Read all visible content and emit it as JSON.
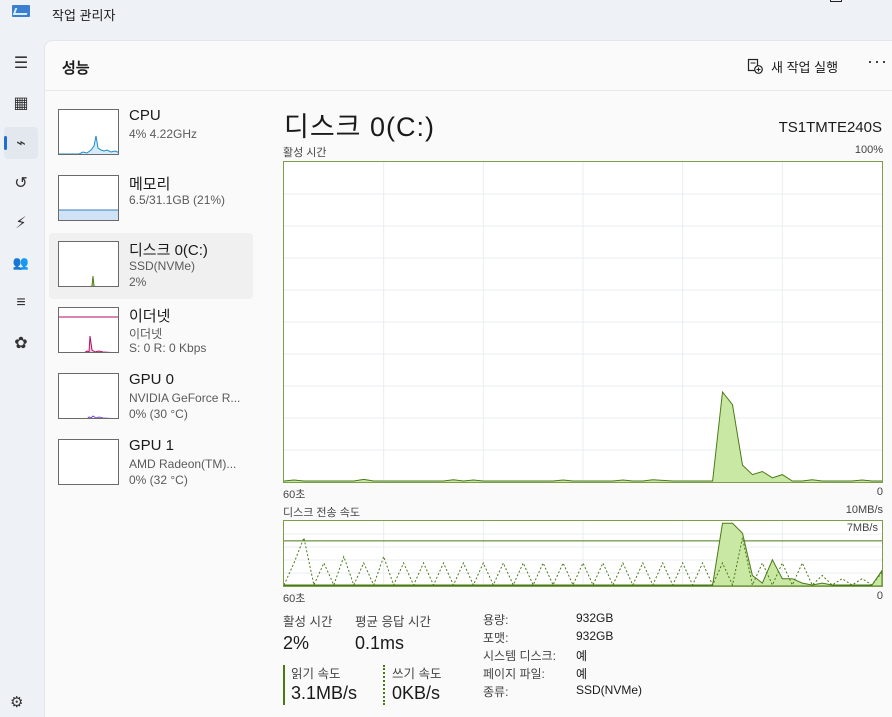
{
  "window": {
    "title": "작업 관리자"
  },
  "header": {
    "page_title": "성능",
    "new_task_label": "새 작업 실행",
    "more_label": "···"
  },
  "rail": {
    "items": [
      {
        "name": "hamburger-icon",
        "glyph": "☰"
      },
      {
        "name": "processes-icon",
        "glyph": "▦"
      },
      {
        "name": "performance-icon",
        "glyph": "⌁"
      },
      {
        "name": "app-history-icon",
        "glyph": "↺"
      },
      {
        "name": "startup-apps-icon",
        "glyph": "⚡"
      },
      {
        "name": "users-icon",
        "glyph": "👥"
      },
      {
        "name": "details-icon",
        "glyph": "≡"
      },
      {
        "name": "services-icon",
        "glyph": "✿"
      }
    ],
    "settings_glyph": "⚙"
  },
  "devices": [
    {
      "name": "CPU",
      "line1": "4% 4.22GHz",
      "line2": ""
    },
    {
      "name": "메모리",
      "line1": "6.5/31.1GB (21%)",
      "line2": ""
    },
    {
      "name": "디스크 0(C:)",
      "line1": "SSD(NVMe)",
      "line2": "2%"
    },
    {
      "name": "이더넷",
      "line1": "이더넷",
      "line2": "S: 0 R: 0 Kbps"
    },
    {
      "name": "GPU 0",
      "line1": "NVIDIA GeForce R...",
      "line2": "0% (30 °C)"
    },
    {
      "name": "GPU 1",
      "line1": "AMD Radeon(TM)...",
      "line2": "0% (32 °C)"
    }
  ],
  "detail": {
    "title": "디스크 0(C:)",
    "model": "TS1TMTE240S",
    "active_chart": {
      "label": "활성 시간",
      "max_label": "100%",
      "x_left": "60초",
      "x_right": "0",
      "values": [
        0,
        0.3,
        0,
        0,
        0,
        0,
        0,
        0,
        0.5,
        0,
        0,
        0,
        0,
        0,
        0,
        0,
        0,
        0.4,
        0,
        0.3,
        0,
        0,
        0,
        0,
        0,
        0,
        0,
        0,
        0.3,
        0,
        0,
        0,
        0,
        0,
        0.3,
        0,
        0,
        0.4,
        0.2,
        0,
        0,
        0,
        0,
        0,
        28,
        24,
        5,
        2,
        3,
        1,
        2,
        0,
        0,
        0.4,
        0,
        0,
        0,
        0,
        0.3,
        0,
        0
      ]
    },
    "transfer_chart": {
      "label": "디스크 전송 속도",
      "max_label": "10MB/s",
      "ref_label": "7MB/s",
      "x_left": "60초",
      "x_right": "0",
      "read": [
        0,
        0,
        0,
        0,
        0,
        0,
        0,
        0,
        0,
        0,
        0,
        0,
        0,
        0,
        0,
        0,
        0,
        0,
        0,
        0,
        0,
        0,
        0,
        0,
        0,
        0,
        0,
        0,
        0,
        0,
        0,
        0,
        0,
        0,
        0,
        0,
        0,
        0,
        0,
        0,
        0,
        0,
        0,
        0,
        9.8,
        9.8,
        8.2,
        1.5,
        0.3,
        4,
        1,
        1,
        0.3,
        0,
        0.3,
        0,
        0,
        0,
        0,
        0,
        2.3
      ],
      "write": [
        0,
        3.5,
        7.5,
        0,
        3.5,
        0,
        4.5,
        0,
        3.5,
        0,
        4.5,
        0,
        3.5,
        0,
        3.5,
        0,
        3.5,
        0,
        3.5,
        0,
        3.5,
        0,
        3.5,
        0,
        3.5,
        0,
        3.5,
        0,
        3.5,
        0,
        3.5,
        0,
        3.5,
        0,
        3.5,
        0,
        3.5,
        0,
        3.5,
        0,
        3.5,
        0,
        3.5,
        0,
        3.5,
        0,
        7.5,
        0,
        3.5,
        0,
        3.5,
        0,
        3.5,
        0,
        1.5,
        0,
        1,
        0,
        1,
        0,
        2
      ]
    }
  },
  "stats": {
    "active_time_label": "활성 시간",
    "active_time_value": "2%",
    "avg_response_label": "평균 응답 시간",
    "avg_response_value": "0.1ms",
    "read_speed_label": "읽기 속도",
    "read_speed_value": "3.1MB/s",
    "write_speed_label": "쓰기 속도",
    "write_speed_value": "0KB/s",
    "props": [
      {
        "key": "용량:",
        "value": "932GB"
      },
      {
        "key": "포맷:",
        "value": "932GB"
      },
      {
        "key": "시스템 디스크:",
        "value": "예"
      },
      {
        "key": "페이지 파일:",
        "value": "예"
      },
      {
        "key": "종류:",
        "value": "SSD(NVMe)"
      }
    ]
  },
  "colors": {
    "disk_line": "#4a7a16",
    "disk_fill": "#c9e8a4",
    "cpu": "#1c8fc9",
    "memory_fill": "#cfe2f6",
    "memory_line": "#3b7fc0",
    "ethernet": "#b40e66",
    "gpu": "#7a4bd0",
    "accent": "#1e6fd0"
  }
}
